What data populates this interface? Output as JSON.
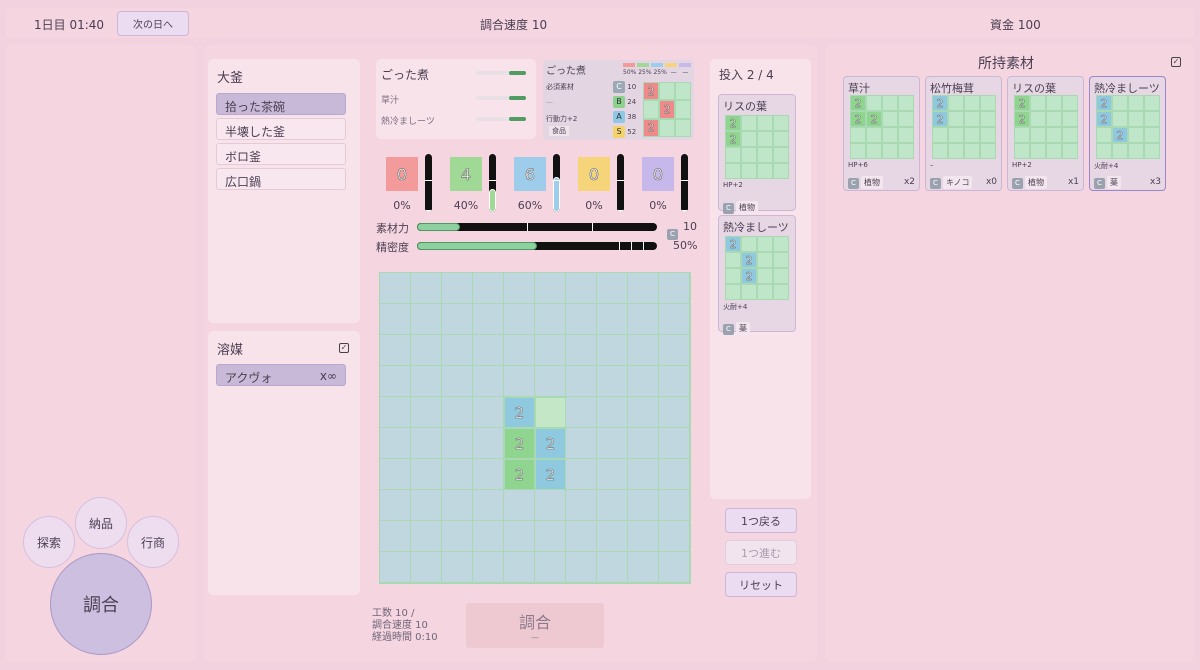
{
  "topbar": {
    "day_time": "1日目 01:40",
    "next_day": "次の日へ",
    "speed": "調合速度 10",
    "money": "資金 100"
  },
  "nav": {
    "explore": "探索",
    "deliver": "納品",
    "merchant": "行商",
    "craft": "調合"
  },
  "kettle": {
    "title": "大釜",
    "items": [
      "拾った茶碗",
      "半壊した釜",
      "ボロ釜",
      "広口鍋"
    ]
  },
  "solvent": {
    "title": "溶媒",
    "item": "アクヴォ",
    "count": "x∞"
  },
  "recipe": {
    "name": "ごった煮",
    "ingredients": [
      "草汁",
      "熱冷ましーツ"
    ]
  },
  "recipe_card": {
    "name": "ごった煮",
    "pcts": "50% 25% 25%  —   —",
    "required": "必須素材",
    "dash": "—",
    "effect": "行動力+2",
    "category": "食品",
    "tiers": [
      {
        "g": "C",
        "v": "10"
      },
      {
        "g": "B",
        "v": "24"
      },
      {
        "g": "A",
        "v": "38"
      },
      {
        "g": "S",
        "v": "52"
      }
    ]
  },
  "elements": [
    {
      "value": "0",
      "pct": "0%",
      "color": "#f39a9a",
      "fill": 0
    },
    {
      "value": "4",
      "pct": "40%",
      "color": "#9fd995",
      "fill": 0.4
    },
    {
      "value": "6",
      "pct": "60%",
      "color": "#9dcdea",
      "fill": 0.6
    },
    {
      "value": "0",
      "pct": "0%",
      "color": "#f6d57a",
      "fill": 0
    },
    {
      "value": "0",
      "pct": "0%",
      "color": "#c7b8ec",
      "fill": 0
    }
  ],
  "bars": {
    "power_label": "素材力",
    "power_grade": "C",
    "power_value": "10",
    "power_fill": 0.18,
    "precision_label": "精密度",
    "precision_value": "50%",
    "precision_fill": 0.5
  },
  "grid": [
    {
      "r": 4,
      "c": 4,
      "v": "2",
      "col": "b"
    },
    {
      "r": 4,
      "c": 5,
      "v": "",
      "col": "g"
    },
    {
      "r": 5,
      "c": 4,
      "v": "2",
      "col": "g"
    },
    {
      "r": 5,
      "c": 5,
      "v": "2",
      "col": "b"
    },
    {
      "r": 6,
      "c": 4,
      "v": "2",
      "col": "g"
    },
    {
      "r": 6,
      "c": 5,
      "v": "2",
      "col": "b"
    }
  ],
  "input": {
    "title": "投入 2 / 4",
    "cards": [
      {
        "name": "リスの葉",
        "effect": "HP+2",
        "grade": "C",
        "tag": "植物"
      },
      {
        "name": "熱冷ましーツ",
        "effect": "火耐+4",
        "grade": "C",
        "tag": "薬"
      }
    ]
  },
  "controls": {
    "undo": "1つ戻る",
    "redo": "1つ進む",
    "reset": "リセット"
  },
  "footer": {
    "work": "工数 10 /",
    "speed": "調合速度 10",
    "elapsed": "経過時間 0:10",
    "craft": "調合",
    "craft_sub": "—"
  },
  "inventory": {
    "title": "所持素材",
    "items": [
      {
        "name": "草汁",
        "effect": "HP+6",
        "grade": "C",
        "tag": "植物",
        "count": "x2"
      },
      {
        "name": "松竹梅茸",
        "effect": "–",
        "grade": "C",
        "tag": "キノコ",
        "count": "x0"
      },
      {
        "name": "リスの葉",
        "effect": "HP+2",
        "grade": "C",
        "tag": "植物",
        "count": "x1"
      },
      {
        "name": "熱冷ましーツ",
        "effect": "火耐+4",
        "grade": "C",
        "tag": "薬",
        "count": "x3"
      }
    ]
  }
}
